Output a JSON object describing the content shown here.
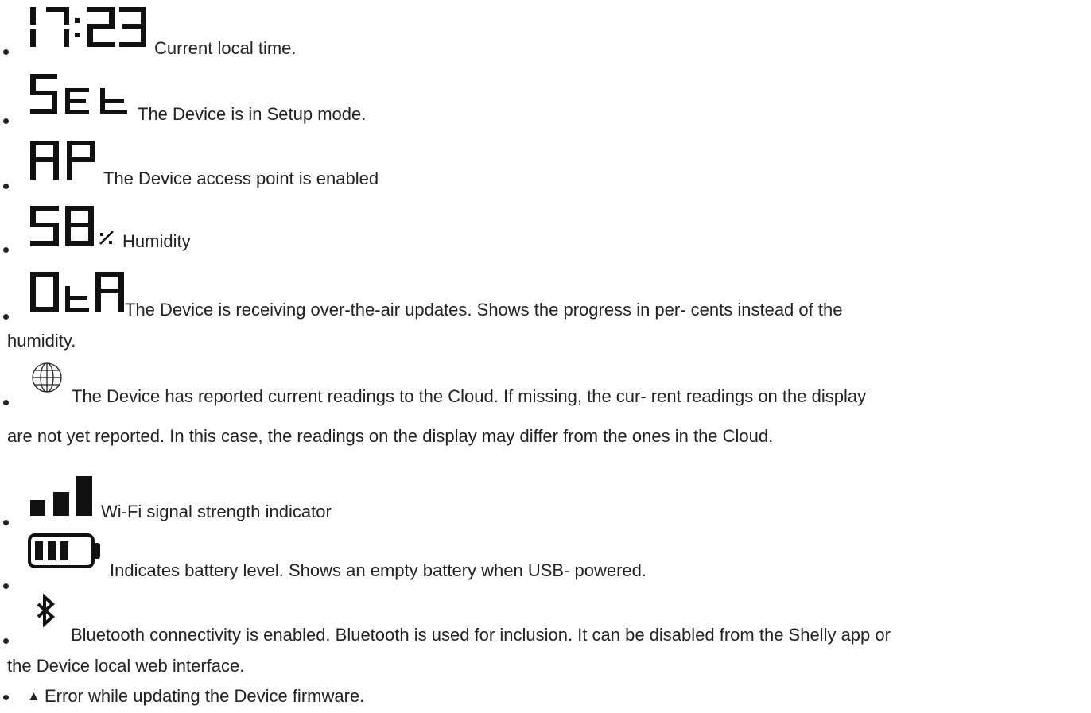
{
  "items": [
    {
      "icon": "clock-display-icon",
      "display": "17:23",
      "text": "Current local time."
    },
    {
      "icon": "setup-mode-display-icon",
      "display": "SEt",
      "text": "The Device is in Setup mode."
    },
    {
      "icon": "access-point-display-icon",
      "display": "AP",
      "text": "The Device access point is enabled"
    },
    {
      "icon": "humidity-display-icon",
      "display": "58%",
      "text": "Humidity"
    },
    {
      "icon": "ota-display-icon",
      "display": "OtA",
      "text": "The Device is receiving over-the-air updates. Shows the progress in per- cents instead of the",
      "text_cont": "humidity."
    },
    {
      "icon": "globe-icon",
      "text": "The Device has reported current readings to the Cloud. If missing, the cur- rent readings on the display",
      "text_cont": "are not yet reported. In this case, the readings on the display may differ from the ones in the Cloud."
    },
    {
      "icon": "wifi-signal-icon",
      "text": "Wi-Fi signal strength indicator"
    },
    {
      "icon": "battery-icon",
      "text": "Indicates battery level. Shows an empty battery when USB- powered."
    },
    {
      "icon": "bluetooth-icon",
      "text": "Bluetooth connectivity is enabled. Bluetooth is used for inclusion. It can be disabled from the Shelly app or",
      "text_cont": "the Device local web interface."
    },
    {
      "icon": "warning-triangle-icon",
      "symbol": "▲",
      "text": "Error while updating the Device firmware."
    }
  ]
}
